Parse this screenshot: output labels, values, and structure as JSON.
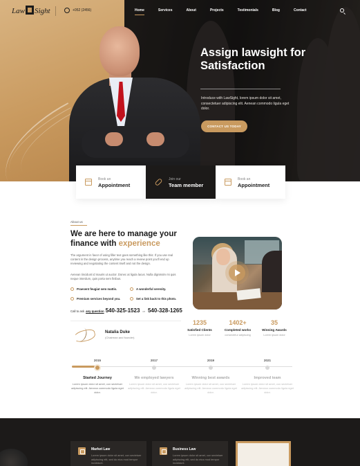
{
  "nav": {
    "logo_left": "Law",
    "logo_right": "Sight",
    "phone": "+052 (2456)",
    "menu": [
      "Home",
      "Services",
      "About",
      "Projects",
      "Testimonials",
      "Blog",
      "Contact"
    ]
  },
  "hero": {
    "title": "Assign lawsight for Satisfaction",
    "text": "Introduce with LawSight, lorem ipsum dolor sit amet, consectetuer adipiscing elit. Aenean commodo ligula eget dolor.",
    "button": "CONTACT US TODAY"
  },
  "features": [
    {
      "small": "Book an",
      "big": "Appointment",
      "icon": "calendar-icon"
    },
    {
      "small": "Join our",
      "big": "Team member",
      "icon": "link-icon"
    },
    {
      "small": "Book an",
      "big": "Appointment",
      "icon": "calendar-icon"
    }
  ],
  "about": {
    "tag": "About us",
    "title_main": "We are here to manage your finance with ",
    "title_accent": "experience",
    "para1": "The argument in favor of using filler text goes something like this: If you use real content in the design process, anytime you reach a review point you'll end up reviewing and negotiating the content itself and not the design.",
    "para2": "Aenean tincidunt id mauris ut auctor. Donec at ligula lacus. Nulla dignissim mi quis neque interdum, quis porta sem finibus.",
    "bullets": [
      "Praesent feugiat sem mattis.",
      "A wonderful serenity.",
      "Premium services beyond you.",
      "Set a link back to this photo."
    ],
    "call_prefix": "Call to ask",
    "call_link": "any question",
    "phone1": "540-325-1523",
    "call_or": "or",
    "phone2": "540-328-1265",
    "signer_name": "Natalia Duke",
    "signer_role": "(Chairman and founder)"
  },
  "stats": [
    {
      "num": "1235",
      "label": "Satisfied Clients",
      "sub": "Lorem ipsum dolor"
    },
    {
      "num": "1402+",
      "label": "Completed works",
      "sub": "consectetur adipiscing"
    },
    {
      "num": "35",
      "label": "Winning Awards",
      "sub": "Lorem ipsum dolor"
    }
  ],
  "timeline": [
    {
      "year": "2015",
      "title": "Started Journey",
      "text": "Lorem ipsum dolor sit amet, con sectetuer adipiscing elit. Aenean commodo ligula eget dolor."
    },
    {
      "year": "2017",
      "title": "We employed lawyers",
      "text": "Lorem ipsum dolor sit amet, con sectetuer adipiscing elit. Aenean commodo ligula eget dolor."
    },
    {
      "year": "2019",
      "title": "Winning best awards",
      "text": "Lorem ipsum dolor sit amet, con sectetuer adipiscing elit. Aenean commodo ligula eget dolor."
    },
    {
      "year": "2021",
      "title": "Improved team",
      "text": "Lorem ipsum dolor sit amet, con sectetuer adipiscing elit. Aenean commodo ligula eget dolor."
    }
  ],
  "services": [
    {
      "title": "Market Law",
      "text": "Lorem ipsum dolor sit amet, con sectetuer adipiscing elit, sed do eius mod tempor incididunt."
    },
    {
      "title": "Business Law",
      "text": "Lorem ipsum dolor sit amet, con sectetuer adipiscing elit, sed do eius mod tempor incididunt."
    }
  ],
  "colors": {
    "accent": "#c99a5f",
    "dark": "#1c1a19"
  }
}
